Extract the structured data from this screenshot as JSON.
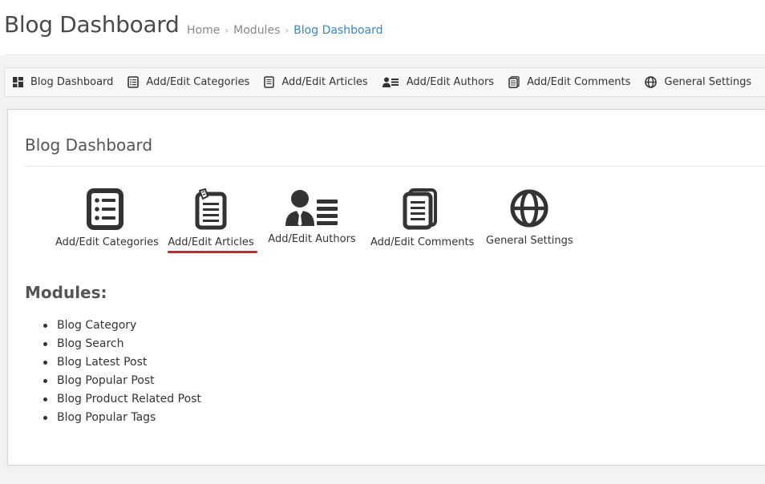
{
  "header": {
    "title": "Blog Dashboard",
    "breadcrumb": [
      "Home",
      "Modules",
      "Blog Dashboard"
    ],
    "breadcrumb_separator": "›"
  },
  "toolbar": {
    "items": [
      {
        "label": "Blog Dashboard",
        "icon": "dashboard-icon"
      },
      {
        "label": "Add/Edit Categories",
        "icon": "list-icon"
      },
      {
        "label": "Add/Edit Articles",
        "icon": "document-icon"
      },
      {
        "label": "Add/Edit Authors",
        "icon": "author-icon"
      },
      {
        "label": "Add/Edit Comments",
        "icon": "comments-icon"
      },
      {
        "label": "General Settings",
        "icon": "globe-icon"
      }
    ]
  },
  "panel": {
    "title": "Blog Dashboard",
    "tiles": [
      {
        "label": "Add/Edit Categories",
        "icon": "list-icon"
      },
      {
        "label": "Add/Edit Articles",
        "icon": "document-icon"
      },
      {
        "label": "Add/Edit Authors",
        "icon": "author-icon"
      },
      {
        "label": "Add/Edit Comments",
        "icon": "comments-icon"
      },
      {
        "label": "General Settings",
        "icon": "globe-icon"
      }
    ],
    "highlight_color": "#e02020"
  },
  "modules": {
    "title": "Modules:",
    "items": [
      "Blog Category",
      "Blog Search",
      "Blog Latest Post",
      "Blog Popular Post",
      "Blog Product Related Post",
      "Blog Popular Tags"
    ]
  },
  "colors": {
    "link": "#3a87c7",
    "icon": "#333333"
  }
}
